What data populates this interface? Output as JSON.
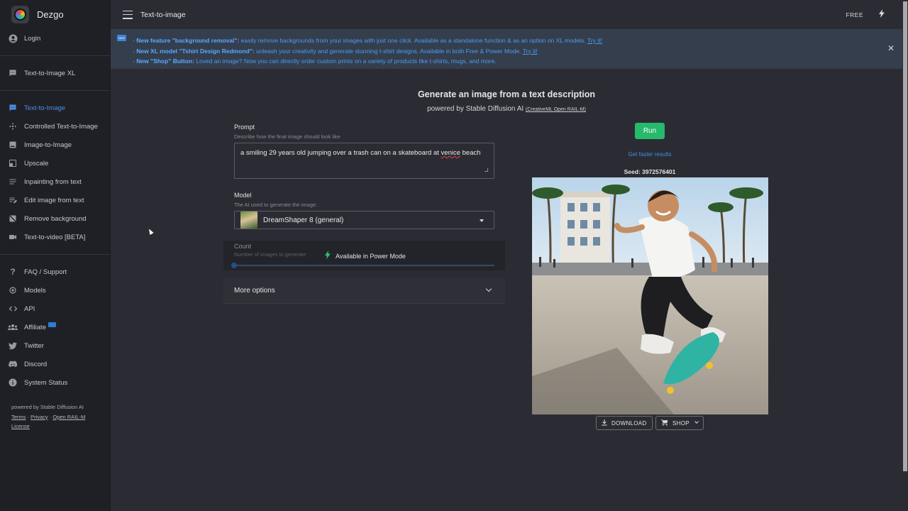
{
  "app": {
    "name": "Dezgo",
    "page_title": "Text-to-image",
    "plan": "FREE"
  },
  "sidebar": {
    "login": "Login",
    "xl": "Text-to-Image XL",
    "tools": [
      {
        "label": "Text-to-Image",
        "icon": "chat-icon"
      },
      {
        "label": "Controlled Text-to-Image",
        "icon": "move-icon"
      },
      {
        "label": "Image-to-Image",
        "icon": "image-icon"
      },
      {
        "label": "Upscale",
        "icon": "upscale-icon"
      },
      {
        "label": "Inpainting from text",
        "icon": "lines-icon"
      },
      {
        "label": "Edit image from text",
        "icon": "edit-lines-icon"
      },
      {
        "label": "Remove background",
        "icon": "no-image-icon"
      },
      {
        "label": "Text-to-video [BETA]",
        "icon": "video-icon"
      }
    ],
    "links": [
      {
        "label": "FAQ / Support",
        "icon": "question-icon"
      },
      {
        "label": "Models",
        "icon": "models-icon"
      },
      {
        "label": "API",
        "icon": "code-icon"
      },
      {
        "label": "Affiliate",
        "icon": "people-icon"
      },
      {
        "label": "Twitter",
        "icon": "twitter-icon"
      },
      {
        "label": "Discord",
        "icon": "discord-icon"
      },
      {
        "label": "System Status",
        "icon": "info-icon"
      }
    ],
    "footer": {
      "powered": "powered by Stable Diffusion AI",
      "terms": "Terms",
      "sep1": " · ",
      "privacy": "Privacy",
      "sep2": " · ",
      "license": "Open RAIL-M License"
    }
  },
  "announcement": {
    "line1_bold": "New feature \"background removal\":",
    "line1_text": " easily remove backgrounds from your images with just one click. Available as a standalone function & as an option on XL models. ",
    "line1_link": "Try it!",
    "line2_bold": "New XL model \"Tshirt Design Redmond\":",
    "line2_text": " unleash your creativity and generate stunning t-shirt designs. Available in both Free & Power Mode. ",
    "line2_link": "Try it!",
    "line3_bold": "New \"Shop\" Button:",
    "line3_text": " Loved an image? Now you can directly order custom prints on a variety of products like t-shirts, mugs, and more.",
    "prefix": "- "
  },
  "main": {
    "headline": "Generate an image from a text description",
    "sub": "powered by Stable Diffusion AI ",
    "sub_license": "(CreativeML Open RAIL-M)",
    "prompt": {
      "label": "Prompt",
      "help": "Describe how the final image should look like",
      "value_a": "a smiling 29 years old jumping over a trash can on a skateboard at ",
      "value_b": "venice",
      "value_c": " beach"
    },
    "model": {
      "label": "Model",
      "help": "The AI used to generate the image.",
      "value": "DreamShaper 8 (general)"
    },
    "count": {
      "label": "Count",
      "help": "Number of images to generate",
      "power": "Available in Power Mode"
    },
    "more_options": "More options"
  },
  "result": {
    "run": "Run",
    "faster": "Get faster results",
    "seed": "Seed: 3972576401",
    "download": "DOWNLOAD",
    "shop": "SHOP"
  }
}
